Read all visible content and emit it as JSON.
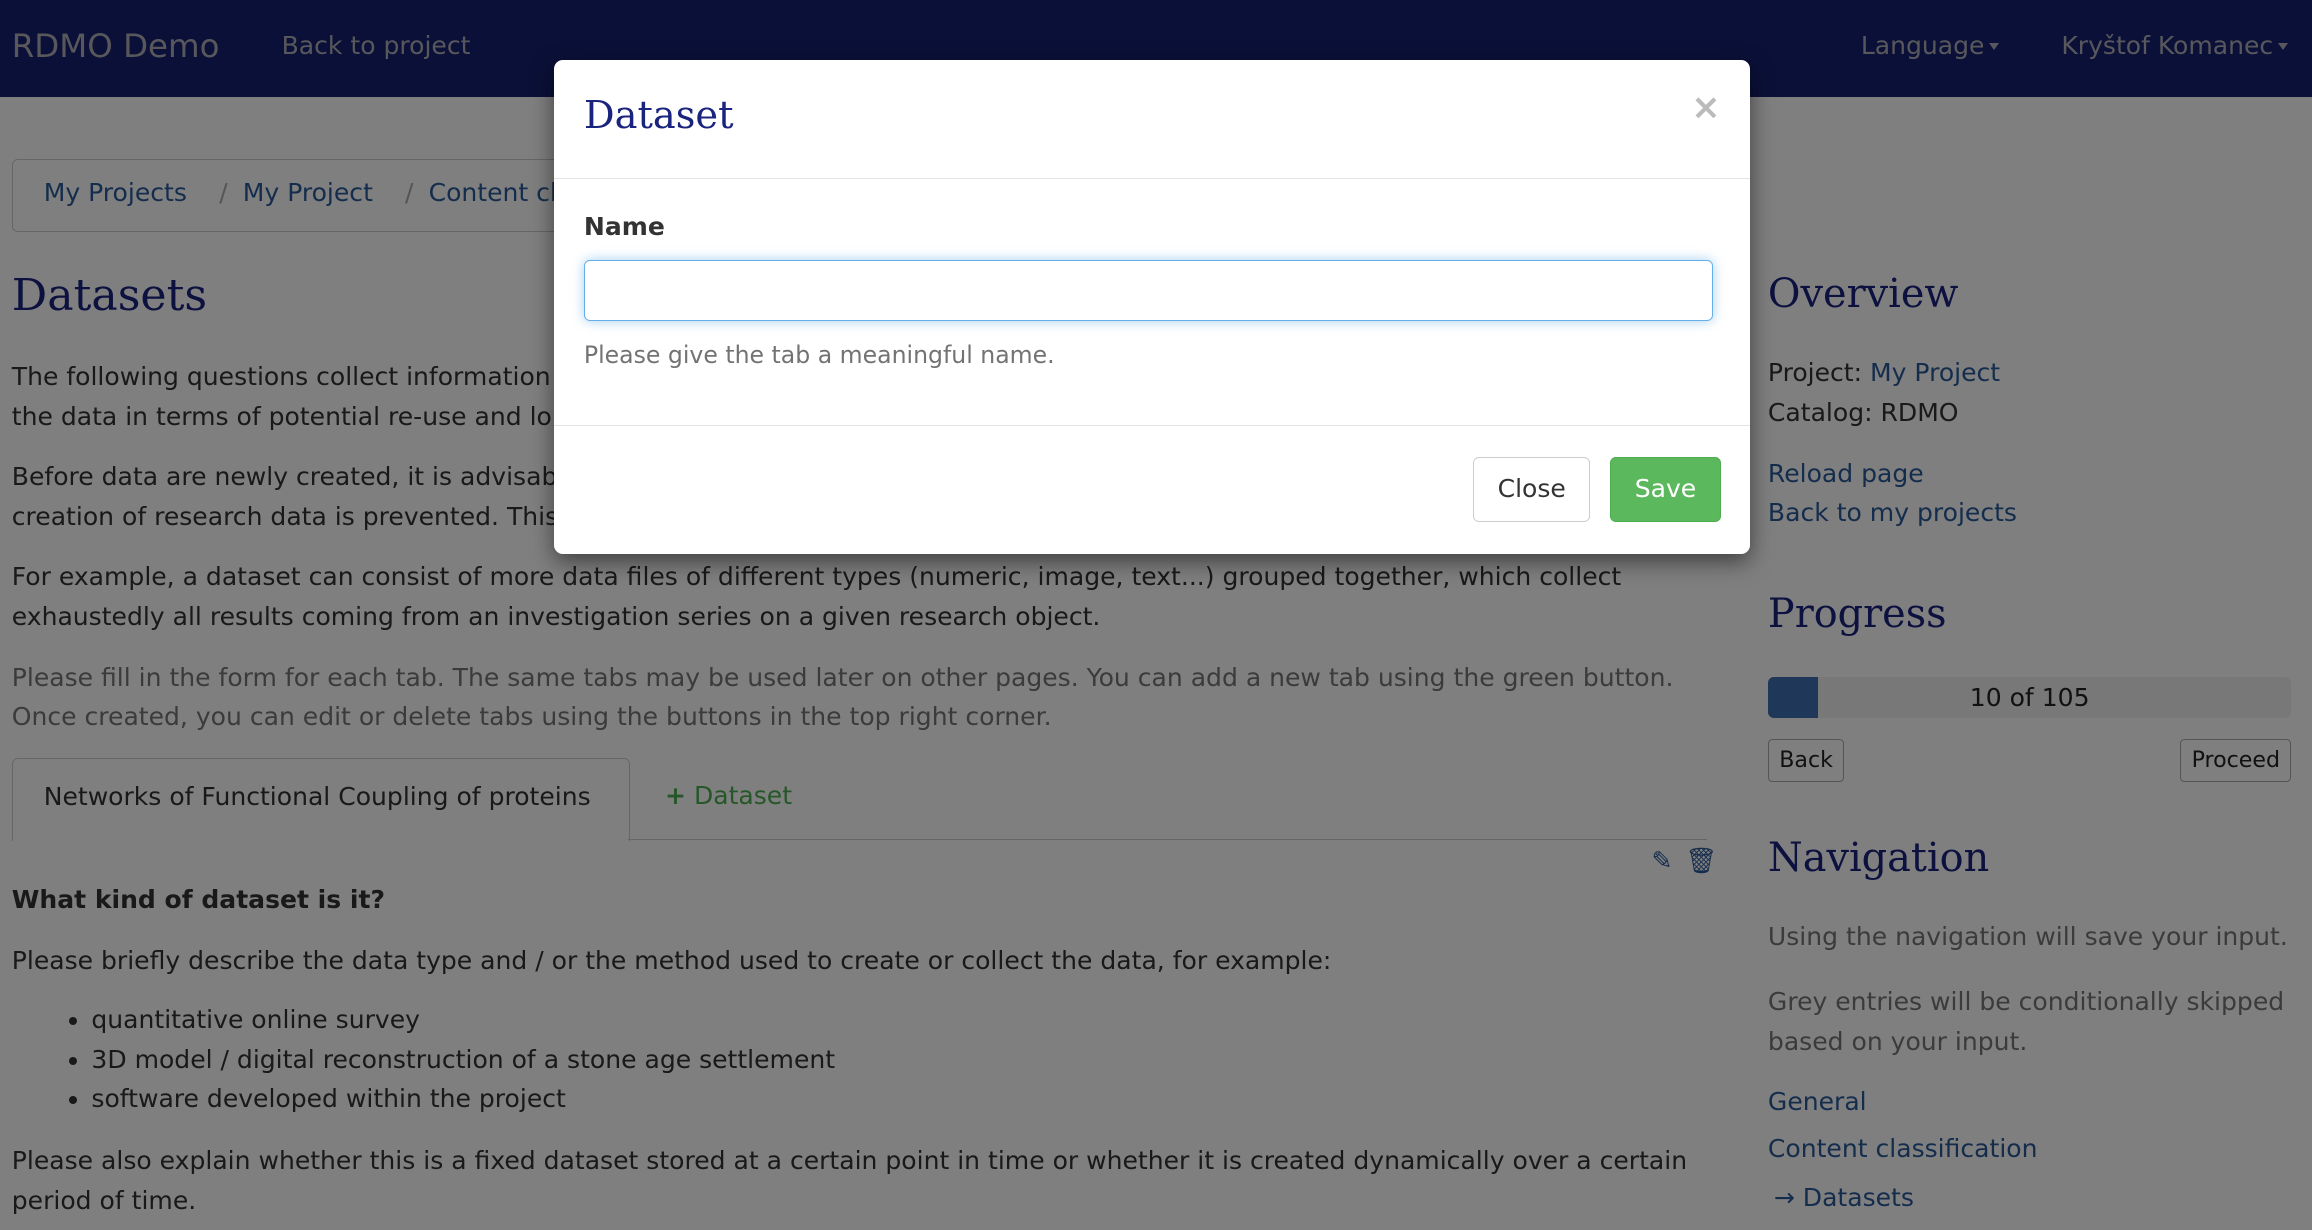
{
  "navbar": {
    "brand": "RDMO Demo",
    "back_to_project": "Back to project",
    "language": "Language",
    "user": "Kryštof Komanec"
  },
  "breadcrumb": [
    "My Projects",
    "My Project",
    "Content cl"
  ],
  "page": {
    "title": "Datasets",
    "intro1": "The following questions collect information",
    "intro1b": "the data in terms of potential re-use and lo",
    "intro2": "Before data are newly created, it is advisab",
    "intro2b": "creation of research data is prevented. This",
    "intro3": "For example, a dataset can consist of more data files of different types (numeric, image, text...) grouped together, which collect exhaustedly all results coming from an investigation series on a given research object.",
    "help": "Please fill in the form for each tab. The same tabs may be used later on other pages. You can add a new tab using the green button. Once created, you can edit or delete tabs using the buttons in the top right corner.",
    "tabs": [
      {
        "label": "Networks of Functional Coupling of proteins"
      }
    ],
    "add_tab": "Dataset",
    "question": "What kind of dataset is it?",
    "question_help": "Please briefly describe the data type and / or the method used to create or collect the data, for example:",
    "examples": [
      "quantitative online survey",
      "3D model / digital reconstruction of a stone age settlement",
      "software developed within the project"
    ],
    "question_help2": "Please also explain whether this is a fixed dataset stored at a certain point in time or whether it is created dynamically over a certain period of time."
  },
  "sidebar": {
    "overview_title": "Overview",
    "project_label": "Project:",
    "project": "My Project",
    "catalog": "Catalog: RDMO",
    "reload": "Reload page",
    "back_projects": "Back to my projects",
    "progress_title": "Progress",
    "progress_text": "10 of 105",
    "progress_value": 10,
    "progress_max": 105,
    "back": "Back",
    "proceed": "Proceed",
    "navigation_title": "Navigation",
    "nav_help1": "Using the navigation will save your input.",
    "nav_help2": "Grey entries will be conditionally skipped based on your input.",
    "nav_items": [
      "General",
      "Content classification",
      "Datasets"
    ],
    "current_arrow": "→"
  },
  "modal": {
    "title": "Dataset",
    "close_symbol": "×",
    "name_label": "Name",
    "name_value": "",
    "help": "Please give the tab a meaningful name.",
    "close": "Close",
    "save": "Save"
  }
}
